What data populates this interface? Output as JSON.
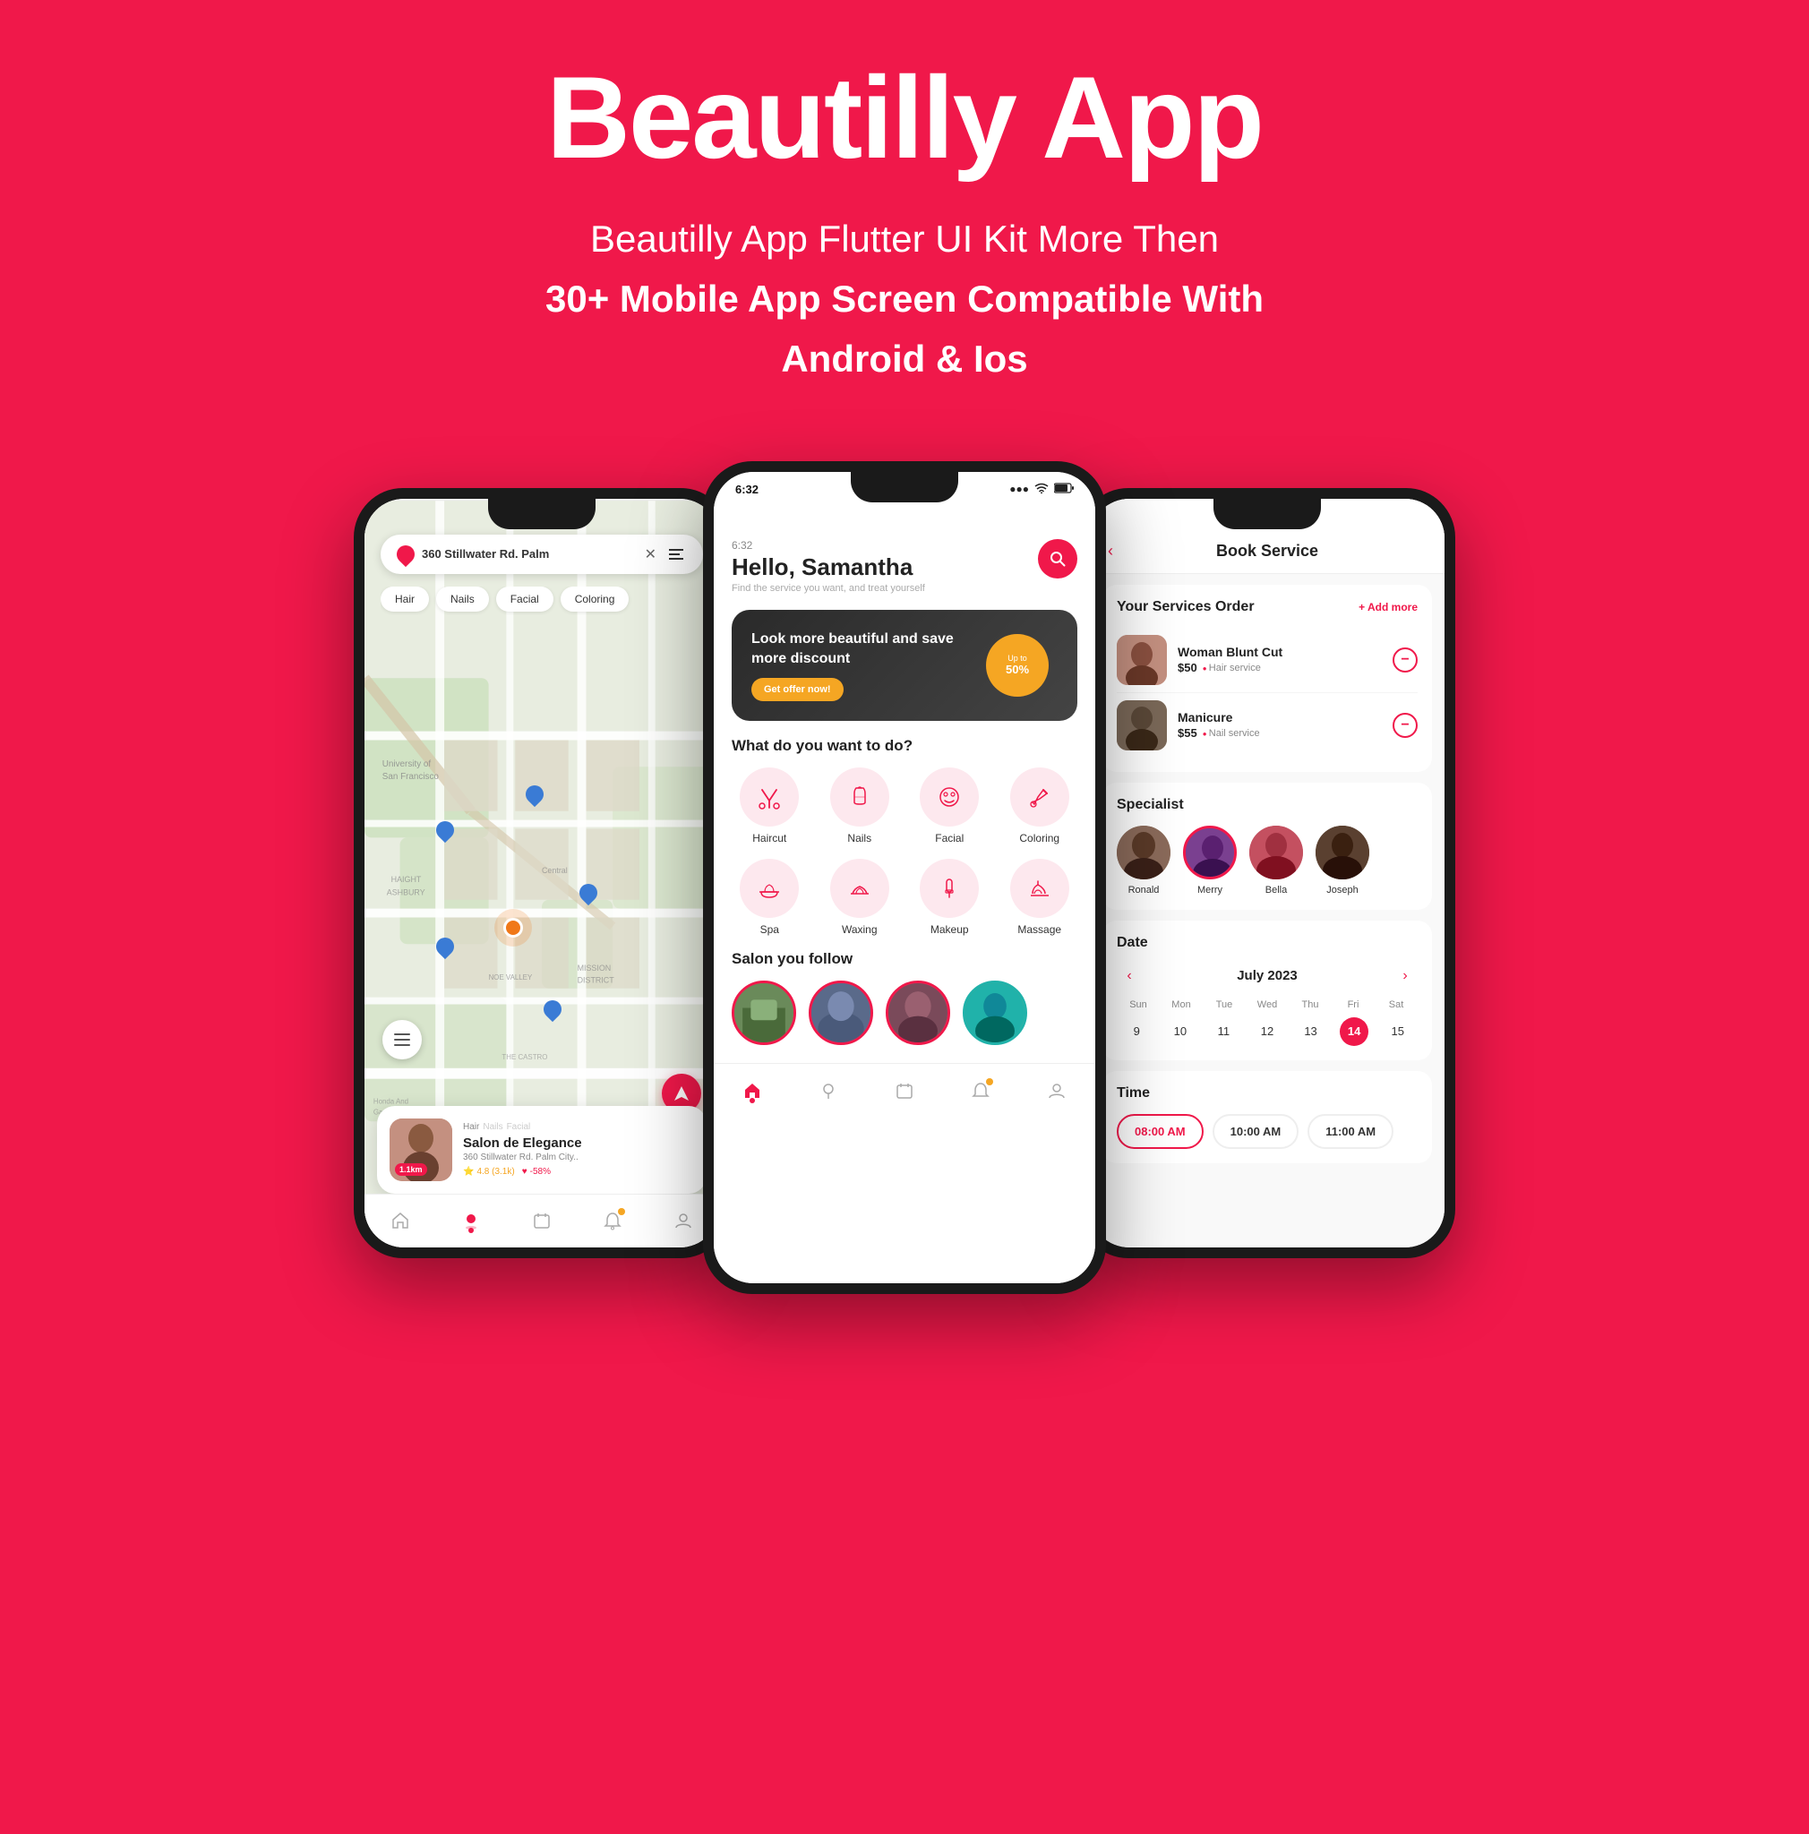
{
  "header": {
    "title": "Beautilly App",
    "tagline_1": "Beautilly App Flutter UI Kit More Then",
    "tagline_2": "30+ Mobile App Screen Compatible With",
    "tagline_3": "Android & Ios"
  },
  "left_phone": {
    "location": "360 Stillwater Rd. Palm",
    "tags": [
      "Hair",
      "Nails",
      "Facial",
      "Coloring"
    ],
    "salon": {
      "tags": [
        "Hair",
        "Nails",
        "Facial"
      ],
      "name": "Salon de Elegance",
      "address": "360 Stillwater Rd. Palm City..",
      "rating": "4.8 (3.1k)",
      "discount": "-58%",
      "distance": "1.1km"
    },
    "nav": [
      "home",
      "location",
      "calendar",
      "notification",
      "profile"
    ]
  },
  "center_phone": {
    "status_time": "6:32",
    "greeting": "Hello, Samantha",
    "subtitle": "Find the service you want, and treat yourself",
    "banner": {
      "title": "Look more beautiful and save more discount",
      "cta": "Get offer now!",
      "badge_top": "Up to",
      "badge_bottom": "50%"
    },
    "section_what": "What do you want to do?",
    "services": [
      {
        "label": "Haircut",
        "icon": "✂️"
      },
      {
        "label": "Nails",
        "icon": "💅"
      },
      {
        "label": "Facial",
        "icon": "😊"
      },
      {
        "label": "Coloring",
        "icon": "🎨"
      },
      {
        "label": "Spa",
        "icon": "🛁"
      },
      {
        "label": "Waxing",
        "icon": "🤲"
      },
      {
        "label": "Makeup",
        "icon": "💄"
      },
      {
        "label": "Massage",
        "icon": "💆"
      }
    ],
    "section_follow": "Salon you follow"
  },
  "right_phone": {
    "title": "Book Service",
    "section_services": "Your Services Order",
    "add_more": "+ Add more",
    "services": [
      {
        "name": "Woman Blunt Cut",
        "price": "$50",
        "type": "Hair service"
      },
      {
        "name": "Manicure",
        "price": "$55",
        "type": "Nail service"
      }
    ],
    "section_specialist": "Specialist",
    "specialists": [
      {
        "name": "Ronald",
        "selected": false
      },
      {
        "name": "Merry",
        "selected": true
      },
      {
        "name": "Bella",
        "selected": false
      },
      {
        "name": "Joseph",
        "selected": false
      }
    ],
    "section_date": "Date",
    "calendar": {
      "month": "July 2023",
      "days_header": [
        "Sun",
        "Mon",
        "Tue",
        "Wed",
        "Thu",
        "Fri",
        "Sat"
      ],
      "days": [
        "9",
        "10",
        "11",
        "12",
        "13",
        "14",
        "15"
      ]
    },
    "section_time": "Time",
    "time_slots": [
      "08:00 AM",
      "10:00 AM",
      "11:00 AM"
    ]
  }
}
